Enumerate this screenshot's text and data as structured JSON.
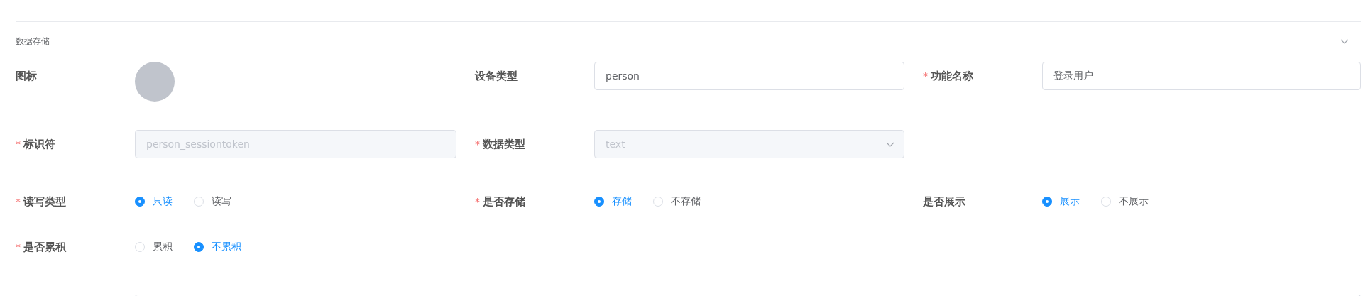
{
  "section": {
    "title": "数据存储"
  },
  "rows": [
    {
      "fields": [
        {
          "kind": "avatar",
          "label": "图标"
        },
        {
          "kind": "input",
          "label": "设备类型",
          "value": "person",
          "disabled": false
        },
        {
          "kind": "input",
          "label": "功能名称",
          "required_mark": "*",
          "value": "登录用户",
          "disabled": false
        }
      ]
    },
    {
      "fields": [
        {
          "kind": "input",
          "label": "标识符",
          "required_mark": "*",
          "value": "person_sessiontoken",
          "disabled": true
        },
        {
          "kind": "select",
          "label": "数据类型",
          "required_mark": "*",
          "value": "text",
          "disabled": true
        }
      ]
    },
    {
      "fields": [
        {
          "kind": "radio",
          "label": "读写类型",
          "required_mark": "*",
          "options": [
            {
              "label": "只读",
              "selected": true
            },
            {
              "label": "读写",
              "selected": false
            }
          ]
        },
        {
          "kind": "radio",
          "label": "是否存储",
          "required_mark": "*",
          "options": [
            {
              "label": "存储",
              "selected": true
            },
            {
              "label": "不存储",
              "selected": false
            }
          ]
        },
        {
          "kind": "radio",
          "label": "是否展示",
          "options": [
            {
              "label": "展示",
              "selected": true
            },
            {
              "label": "不展示",
              "selected": false
            }
          ]
        }
      ]
    },
    {
      "fields": [
        {
          "kind": "radio",
          "label": "是否累积",
          "required_mark": "*",
          "options": [
            {
              "label": "累积",
              "selected": false
            },
            {
              "label": "不累积",
              "selected": true
            }
          ]
        }
      ]
    }
  ]
}
